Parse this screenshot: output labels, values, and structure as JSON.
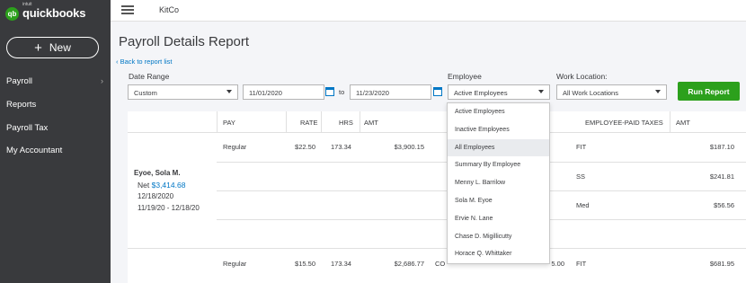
{
  "sidebar": {
    "logo_small": "intuit",
    "logo_main": "quickbooks",
    "logo_mark": "qb",
    "new_label": "New",
    "items": [
      {
        "label": "Payroll",
        "chevron": "›"
      },
      {
        "label": "Reports"
      },
      {
        "label": "Payroll Tax"
      },
      {
        "label": "My Accountant"
      }
    ]
  },
  "topbar": {
    "company": "KitCo"
  },
  "page": {
    "title": "Payroll Details Report",
    "back_link": "‹ Back to report list"
  },
  "filters": {
    "date_range_label": "Date Range",
    "date_range_value": "Custom",
    "from_date": "11/01/2020",
    "to_label": "to",
    "to_date": "11/23/2020",
    "employee_label": "Employee",
    "employee_value": "Active Employees",
    "location_label": "Work Location:",
    "location_value": "All Work Locations",
    "run_label": "Run Report"
  },
  "dropdown": {
    "options": [
      "Active Employees",
      "Inactive Employees",
      "All Employees",
      "Summary By Employee",
      "Menny L. Barrilow",
      "Sola M. Eyoe",
      "Ervie N. Lane",
      "Chase D. Migillicutty",
      "Horace Q. Whittaker"
    ],
    "highlighted": "All Employees"
  },
  "table": {
    "headers": {
      "pay": "PAY",
      "rate": "RATE",
      "hrs": "HRS",
      "amt": "AMT",
      "emp_taxes": "EMPLOYEE-PAID TAXES",
      "amt2": "AMT"
    },
    "employee": {
      "name": "Eyoe, Sola M.",
      "net_label": "Net",
      "net_amount": "$3,414.68",
      "pay_date": "12/18/2020",
      "period": "11/19/20 -  12/18/20"
    },
    "rows": [
      {
        "pay": "Regular",
        "rate": "$22.50",
        "hrs": "173.34",
        "amt": "$3,900.15"
      },
      {
        "pay": "Regular",
        "rate": "$15.50",
        "hrs": "173.34",
        "amt": "$2,686.77",
        "extra": "CO",
        "extra_amt": "5.00"
      }
    ],
    "taxes": [
      {
        "name": "FIT",
        "amt": "$187.10"
      },
      {
        "name": "SS",
        "amt": "$241.81"
      },
      {
        "name": "Med",
        "amt": "$56.56"
      },
      {
        "name": "FIT",
        "amt": "$681.95"
      }
    ]
  }
}
